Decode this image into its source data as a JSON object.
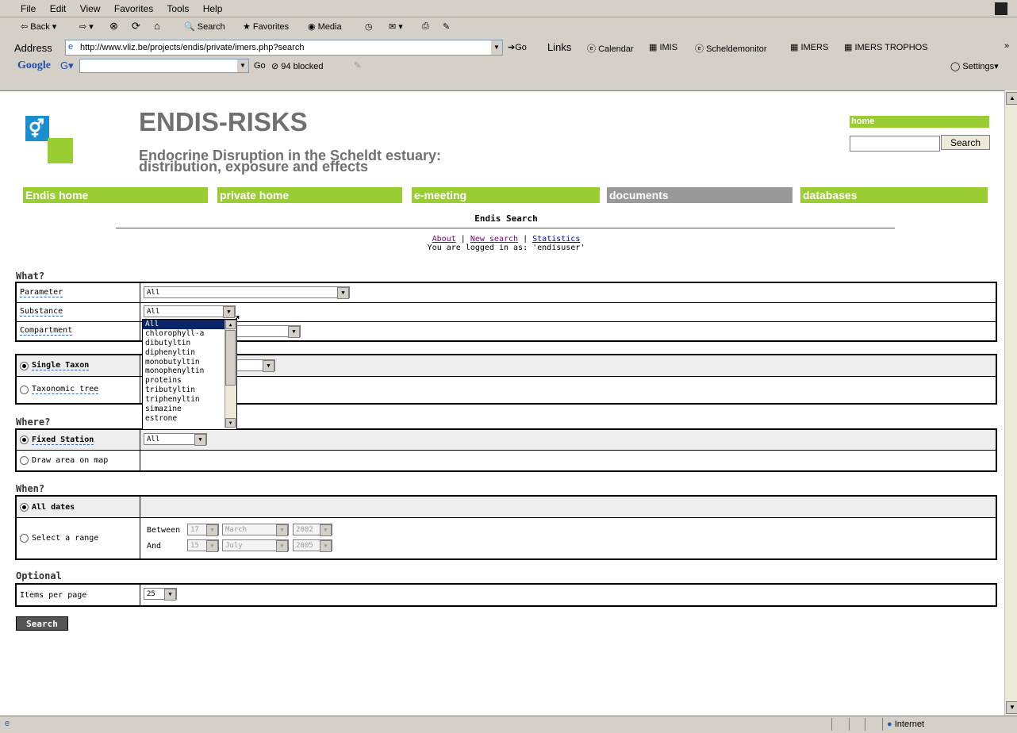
{
  "browser": {
    "menu": [
      "File",
      "Edit",
      "View",
      "Favorites",
      "Tools",
      "Help"
    ],
    "toolbar": {
      "back": "Back",
      "search": "Search",
      "favorites": "Favorites",
      "media": "Media"
    },
    "address_label": "Address",
    "url": "http://www.vliz.be/projects/endis/private/imers.php?search",
    "go_label": "Go",
    "links_label": "Links",
    "links": [
      "Calendar",
      "IMIS",
      "Scheldemonitor",
      "IMERS",
      "IMERS TROPHOS"
    ],
    "google": {
      "logo": "Google",
      "go": "Go",
      "blocked": "94 blocked",
      "settings": "Settings"
    },
    "status_zone": "Internet"
  },
  "page": {
    "title": "ENDIS-RISKS",
    "subtitle_line1": "Endocrine Disruption in the Scheldt estuary:",
    "subtitle_line2": "distribution, exposure and effects",
    "home_label": "home",
    "search_button": "Search",
    "nav": [
      "Endis home",
      "private home",
      "e-meeting",
      "documents",
      "databases"
    ],
    "heading": "Endis Search",
    "links": {
      "about": "About",
      "new_search": "New search",
      "statistics": "Statistics",
      "sep": "|"
    },
    "logged_in": "You are logged in as: 'endisuser'"
  },
  "form": {
    "what_title": "What?",
    "parameter_label": "Parameter",
    "parameter_value": "All",
    "substance_label": "Substance",
    "substance_value": "All",
    "compartment_label": "Compartment",
    "single_taxon": "Single Taxon",
    "taxonomic_tree": "Taxonomic tree",
    "where_title": "Where?",
    "fixed_station": "Fixed Station",
    "station_value": "All",
    "draw_area": "Draw area on map",
    "when_title": "When?",
    "all_dates": "All dates",
    "select_range": "Select a range",
    "between": "Between",
    "and": "And",
    "from": {
      "day": "17",
      "month": "March",
      "year": "2002"
    },
    "to": {
      "day": "15",
      "month": "July",
      "year": "2005"
    },
    "optional_title": "Optional",
    "items_per_page_label": "Items per page",
    "items_per_page_value": "25",
    "submit": "Search"
  },
  "dropdown_options": [
    "All",
    "chlorophyll-a",
    "dibutyltin",
    "diphenyltin",
    "monobutyltin",
    "monophenyltin",
    "proteins",
    "tributyltin",
    "triphenyltin",
    "simazine",
    "estrone"
  ],
  "colors": {
    "nav_green": "#9acd32",
    "nav_gray": "#999999",
    "title_gray": "#707070"
  }
}
